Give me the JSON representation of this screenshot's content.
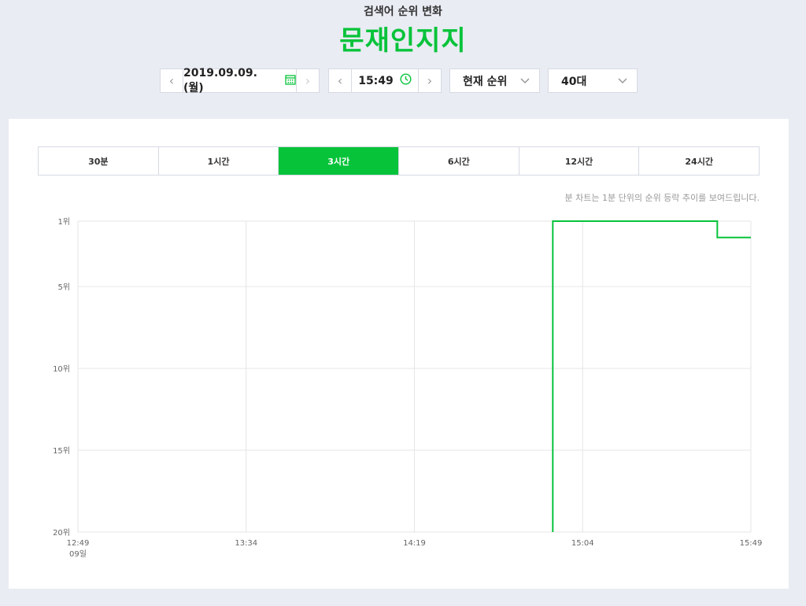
{
  "header": {
    "subtitle": "검색어 순위 변화",
    "title": "문재인지지"
  },
  "controls": {
    "date": "2019.09.09. (월)",
    "time": "15:49",
    "rank_select": "현재 순위",
    "age_select": "40대",
    "icons": {
      "date": "calendar-icon",
      "time": "clock-icon",
      "prev": "chevron-left-icon",
      "next": "chevron-right-icon",
      "dropdown": "chevron-down-icon"
    }
  },
  "tabs": [
    {
      "label": "30분",
      "active": false
    },
    {
      "label": "1시간",
      "active": false
    },
    {
      "label": "3시간",
      "active": true
    },
    {
      "label": "6시간",
      "active": false
    },
    {
      "label": "12시간",
      "active": false
    },
    {
      "label": "24시간",
      "active": false
    }
  ],
  "note": "분 차트는 1분 단위의 순위 등락 추이를 보여드립니다.",
  "colors": {
    "accent": "#07c33a",
    "grid": "#e6e6e6"
  },
  "chart_data": {
    "type": "line",
    "x_ticks": [
      "12:49",
      "13:34",
      "14:19",
      "15:04",
      "15:49"
    ],
    "x_tick_sub": "09일",
    "x_range_minutes": [
      0,
      180
    ],
    "y_ticks": [
      {
        "rank": 1,
        "label": "1위"
      },
      {
        "rank": 5,
        "label": "5위"
      },
      {
        "rank": 10,
        "label": "10위"
      },
      {
        "rank": 15,
        "label": "15위"
      },
      {
        "rank": 20,
        "label": "20위"
      }
    ],
    "y_range": [
      1,
      20
    ],
    "y_reversed": true,
    "grid": true,
    "series": [
      {
        "points": [
          {
            "x": "14:56",
            "y": 20
          },
          {
            "x": "14:56",
            "y": 1
          },
          {
            "x": "15:40",
            "y": 1
          },
          {
            "x": "15:40",
            "y": 2
          },
          {
            "x": "15:49",
            "y": 2
          }
        ]
      }
    ]
  }
}
